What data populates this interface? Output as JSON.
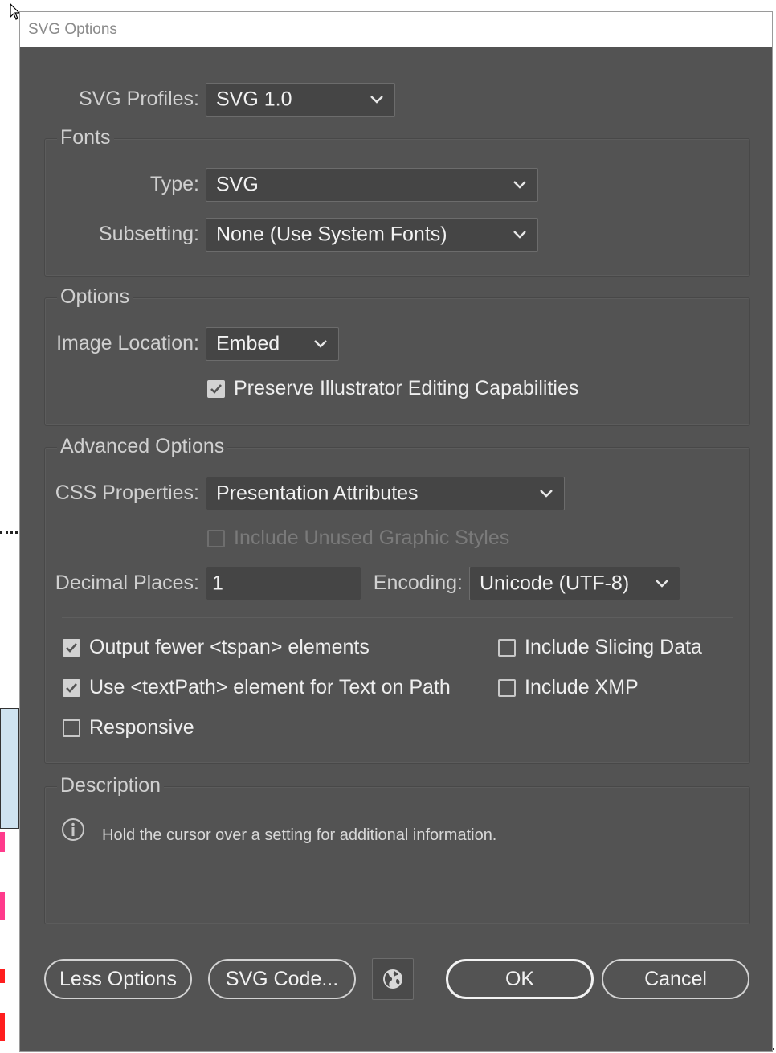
{
  "window": {
    "title": "SVG Options"
  },
  "profiles": {
    "label": "SVG Profiles:",
    "value": "SVG 1.0"
  },
  "fonts": {
    "title": "Fonts",
    "type_label": "Type:",
    "type_value": "SVG",
    "subsetting_label": "Subsetting:",
    "subsetting_value": "None (Use System Fonts)"
  },
  "options": {
    "title": "Options",
    "image_location_label": "Image Location:",
    "image_location_value": "Embed",
    "preserve_label": "Preserve Illustrator Editing Capabilities",
    "preserve_checked": true
  },
  "advanced": {
    "title": "Advanced Options",
    "css_label": "CSS Properties:",
    "css_value": "Presentation Attributes",
    "unused_styles_label": "Include Unused Graphic Styles",
    "decimal_label": "Decimal Places:",
    "decimal_value": "1",
    "encoding_label": "Encoding:",
    "encoding_value": "Unicode (UTF-8)",
    "fewer_tspan_label": "Output fewer <tspan> elements",
    "textpath_label": "Use <textPath> element for Text on Path",
    "responsive_label": "Responsive",
    "slicing_label": "Include Slicing Data",
    "xmp_label": "Include XMP"
  },
  "description": {
    "title": "Description",
    "text": "Hold the cursor over a setting for additional information."
  },
  "buttons": {
    "less_options": "Less Options",
    "svg_code": "SVG Code...",
    "ok": "OK",
    "cancel": "Cancel"
  },
  "colors": {
    "dialog_bg": "#535353",
    "field_bg": "#454545",
    "text": "#eeeeee"
  },
  "icons": [
    "cursor-arrow-icon",
    "chevron-down-icon",
    "checkmark-icon",
    "info-icon",
    "globe-icon"
  ]
}
